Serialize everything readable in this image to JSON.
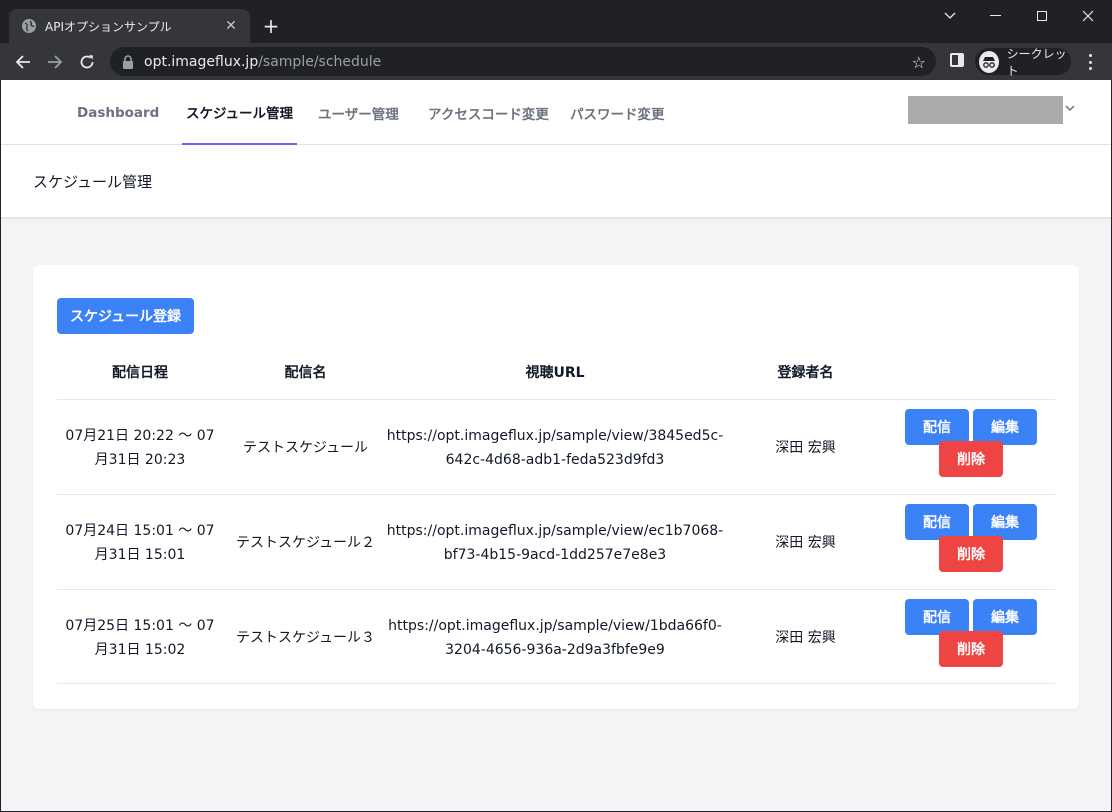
{
  "browser": {
    "tab_title": "APIオプションサンプル",
    "url_host": "opt.imageflux.jp",
    "url_path": "/sample/schedule",
    "incognito_label": "シークレット"
  },
  "nav": {
    "items": [
      {
        "label": "Dashboard"
      },
      {
        "label": "スケジュール管理"
      },
      {
        "label": "ユーザー管理"
      },
      {
        "label": "アクセスコード変更"
      },
      {
        "label": "パスワード変更"
      }
    ],
    "active_index": 1
  },
  "header": {
    "title": "スケジュール管理"
  },
  "main": {
    "add_button": "スケジュール登録",
    "columns": [
      "配信日程",
      "配信名",
      "視聴URL",
      "登録者名"
    ],
    "rows": [
      {
        "date_line1": "07月21日 20:22 〜 07",
        "date_line2": "月31日 20:23",
        "name": "テストスケジュール",
        "url_line1": "https://opt.imageflux.jp/sample/view/3845ed5c-",
        "url_line2": "642c-4d68-adb1-feda523d9fd3",
        "registrant": "深田 宏興"
      },
      {
        "date_line1": "07月24日 15:01 〜 07",
        "date_line2": "月31日 15:01",
        "name": "テストスケジュール２",
        "url_line1": "https://opt.imageflux.jp/sample/view/ec1b7068-",
        "url_line2": "bf73-4b15-9acd-1dd257e7e8e3",
        "registrant": "深田 宏興"
      },
      {
        "date_line1": "07月25日 15:01 〜 07",
        "date_line2": "月31日 15:02",
        "name": "テストスケジュール３",
        "url_line1": "https://opt.imageflux.jp/sample/view/1bda66f0-",
        "url_line2": "3204-4656-936a-2d9a3fbfe9e9",
        "registrant": "深田 宏興"
      }
    ],
    "actions": {
      "deliver": "配信",
      "edit": "編集",
      "delete": "削除"
    }
  },
  "colors": {
    "primary": "#3b82f6",
    "danger": "#ef4444",
    "active_underline": "#6366f1"
  }
}
